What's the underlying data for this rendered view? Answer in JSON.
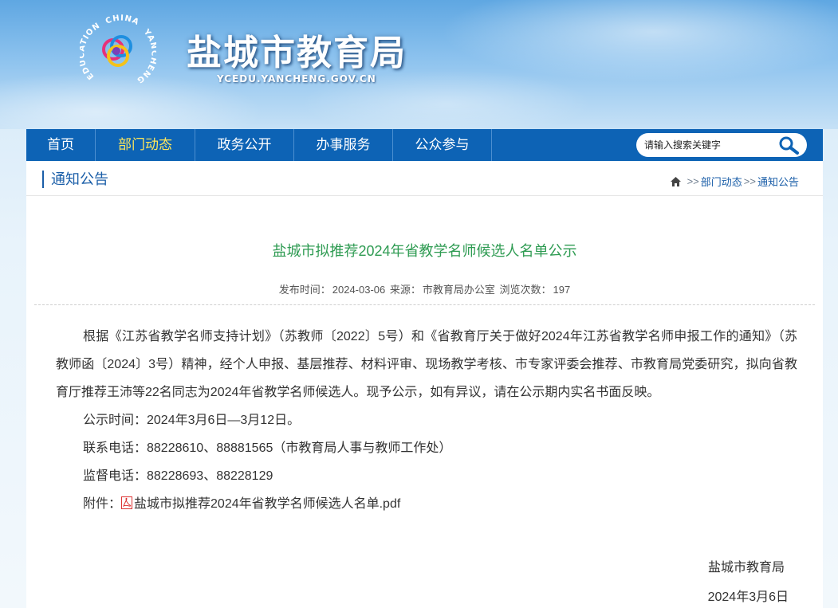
{
  "header": {
    "site_title": "盐城市教育局",
    "site_domain": "YCEDU.YANCHENG.GOV.CN",
    "logo_text_top": "CHINA",
    "logo_text_left": "EDUCATION",
    "logo_text_right": "YANCHENG"
  },
  "nav": {
    "items": [
      {
        "label": "首页"
      },
      {
        "label": "部门动态"
      },
      {
        "label": "政务公开"
      },
      {
        "label": "办事服务"
      },
      {
        "label": "公众参与"
      }
    ],
    "active": "部门动态",
    "search_placeholder": "请输入搜索关键字"
  },
  "section": {
    "title": "通知公告",
    "breadcrumb": {
      "sep1": ">>",
      "item1": "部门动态",
      "sep2": ">>",
      "item2": "通知公告"
    }
  },
  "article": {
    "title": "盐城市拟推荐2024年省教学名师候选人名单公示",
    "meta": {
      "publish_label": "发布时间：",
      "publish_date": "2024-03-06",
      "source_label": "来源：",
      "source": "市教育局办公室",
      "views_label": "浏览次数：",
      "views": "197"
    },
    "paragraph": "根据《江苏省教学名师支持计划》（苏教师〔2022〕5号）和《省教育厅关于做好2024年江苏省教学名师申报工作的通知》（苏教师函〔2024〕3号）精神，经个人申报、基层推荐、材料评审、现场教学考核、市专家评委会推荐、市教育局党委研究，拟向省教育厅推荐王沛等22名同志为2024年省教学名师候选人。现予公示，如有异议，请在公示期内实名书面反映。",
    "period": "公示时间：2024年3月6日—3月12日。",
    "contact": "联系电话：88228610、88881565（市教育局人事与教师工作处）",
    "supervise": "监督电话：88228693、88228129",
    "attachment_label": "附件：",
    "attachment_file": "盐城市拟推荐2024年省教学名师候选人名单.pdf",
    "signature": "盐城市教育局",
    "sign_date": "2024年3月6日"
  },
  "colors": {
    "nav_bg": "#0d63b5",
    "nav_active": "#ffe65a",
    "title_green": "#2e9b52",
    "link_blue": "#1a5ea8"
  }
}
